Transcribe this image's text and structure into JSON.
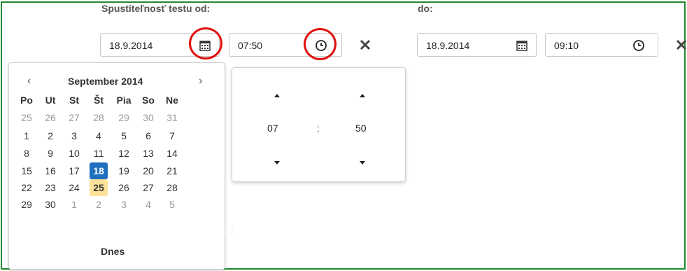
{
  "form": {
    "from_label": "Spustiteľnosť testu od:",
    "to_label": "do:",
    "from_date": "18.9.2014",
    "from_time": "07:50",
    "to_date": "18.9.2014",
    "to_time": "09:10"
  },
  "calendar": {
    "month_title": "September 2014",
    "prev": "‹",
    "next": "›",
    "weekdays": [
      "Po",
      "Ut",
      "St",
      "Št",
      "Pia",
      "So",
      "Ne"
    ],
    "weeks": [
      [
        "25",
        "26",
        "27",
        "28",
        "29",
        "30",
        "31"
      ],
      [
        "1",
        "2",
        "3",
        "4",
        "5",
        "6",
        "7"
      ],
      [
        "8",
        "9",
        "10",
        "11",
        "12",
        "13",
        "14"
      ],
      [
        "15",
        "16",
        "17",
        "18",
        "19",
        "20",
        "21"
      ],
      [
        "22",
        "23",
        "24",
        "25",
        "26",
        "27",
        "28"
      ],
      [
        "29",
        "30",
        "1",
        "2",
        "3",
        "4",
        "5"
      ]
    ],
    "selected_day": "18",
    "today_day": "25",
    "today_button": "Dnes"
  },
  "time_picker": {
    "hours": "07",
    "separator": ":",
    "minutes": "50"
  },
  "colors": {
    "frame": "#1f8a2e",
    "highlight_circle": "#e01010",
    "selected": "#1e6fc0",
    "today": "#fde39a"
  },
  "icons": {
    "date_icon": "calendar-icon",
    "time_icon": "clock-icon",
    "clear_icon": "close-icon"
  }
}
